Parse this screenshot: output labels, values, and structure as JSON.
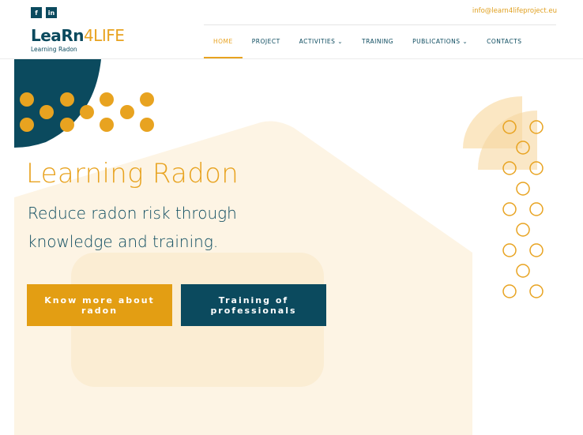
{
  "topbar": {
    "social": [
      {
        "icon": "facebook-icon",
        "glyph": "f"
      },
      {
        "icon": "linkedin-icon",
        "glyph": "in"
      }
    ],
    "email": "info@learn4lifeproject.eu"
  },
  "logo": {
    "part1": "Lea",
    "part2": "Rn",
    "part3": "4LIFE",
    "subtitle": "Learning Radon"
  },
  "nav": {
    "items": [
      {
        "label": "HOME",
        "active": true
      },
      {
        "label": "PROJECT"
      },
      {
        "label": "ACTIVITIES ⌄"
      },
      {
        "label": "TRAINING"
      },
      {
        "label": "PUBLICATIONS ⌄"
      },
      {
        "label": "CONTACTS"
      }
    ]
  },
  "hero": {
    "title": "Learning Radon",
    "subtitle": "Reduce radon risk through knowledge and training.",
    "cta_primary": "Know more about radon",
    "cta_secondary": "Training of professionals"
  },
  "colors": {
    "brand_teal": "#0b4a5e",
    "brand_orange": "#e8a320",
    "button_orange": "#e39e13"
  }
}
